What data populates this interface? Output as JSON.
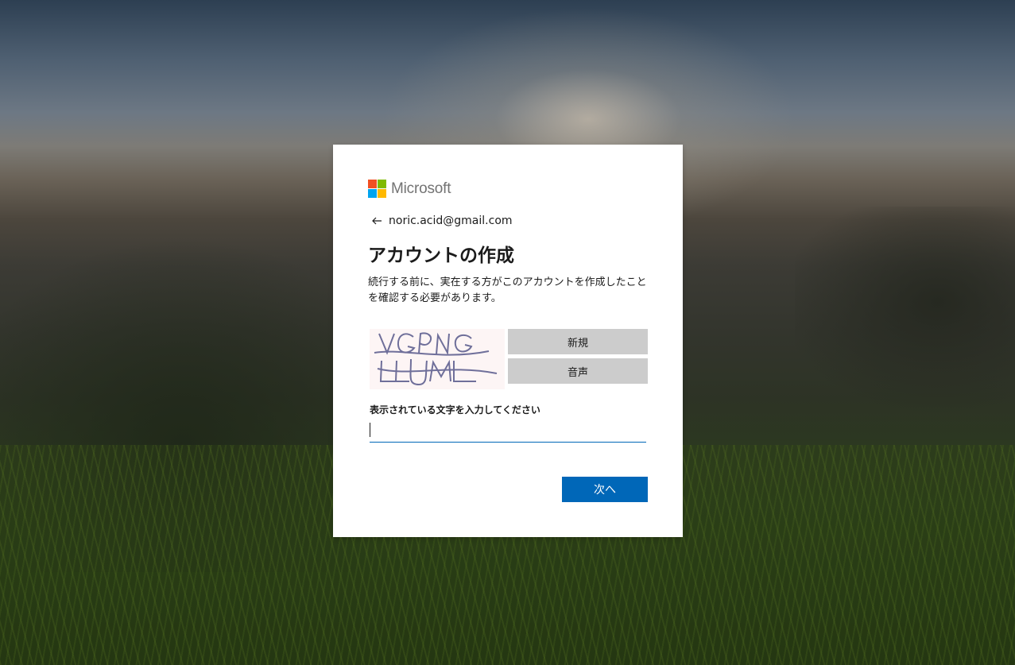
{
  "brand": {
    "name": "Microsoft",
    "logo_colors": [
      "#f25022",
      "#7fba00",
      "#00a4ef",
      "#ffb900"
    ]
  },
  "identity": {
    "back_icon": "back-arrow-icon",
    "email": "noric.acid@gmail.com"
  },
  "page": {
    "title": "アカウントの作成",
    "description": "続行する前に、実在する方がこのアカウントを作成したことを確認する必要があります。"
  },
  "captcha": {
    "image_text": "VGPNG LLJML",
    "new_label": "新規",
    "audio_label": "音声",
    "input_label": "表示されている文字を入力してください",
    "input_value": "",
    "input_placeholder": ""
  },
  "actions": {
    "next_label": "次へ"
  },
  "colors": {
    "accent": "#0067b8",
    "secondary_button": "#cccccc",
    "text": "#1b1b1b"
  }
}
